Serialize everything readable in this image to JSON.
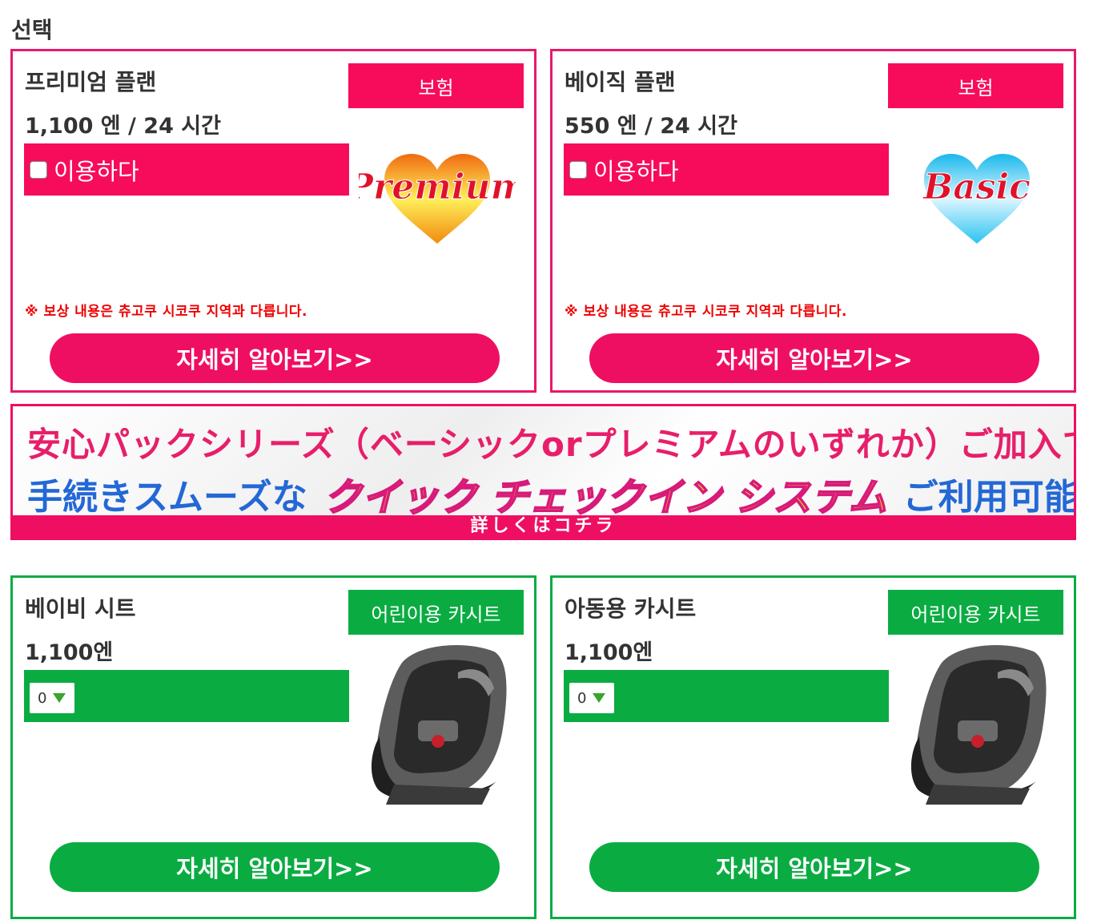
{
  "section_title": "선택",
  "insurance_plans": [
    {
      "name": "프리미엄 플랜",
      "price": "1,100 엔 / 24 시간",
      "tag": "보험",
      "checkbox_label": "이용하다",
      "badge_text": "Premium",
      "note": "※ 보상 내용은 츄고쿠 시코쿠 지역과 다릅니다.",
      "button": "자세히 알아보기>>"
    },
    {
      "name": "베이직 플랜",
      "price": "550 엔 / 24 시간",
      "tag": "보험",
      "checkbox_label": "이용하다",
      "badge_text": "Basic",
      "note": "※ 보상 내용은 츄고쿠 시코쿠 지역과 다릅니다.",
      "button": "자세히 알아보기>>"
    }
  ],
  "banner": {
    "line1": "安心パックシリーズ（ベーシックorプレミアムのいずれか）ご加入で",
    "line2_a": "手続きスムーズな",
    "line2_b": "クイック チェックイン システム",
    "line2_c": "ご利用可能!!",
    "footer": "詳しくはコチラ"
  },
  "child_seats": [
    {
      "name": "베이비 시트",
      "price": "1,100엔",
      "tag": "어린이용 카시트",
      "quantity": "0",
      "button": "자세히 알아보기>>"
    },
    {
      "name": "아동용 카시트",
      "price": "1,100엔",
      "tag": "어린이용 카시트",
      "quantity": "0",
      "button": "자세히 알아보기>>"
    }
  ],
  "colors": {
    "pink": "#f70c5b",
    "green": "#0aac42",
    "note_red": "#ee0000"
  }
}
